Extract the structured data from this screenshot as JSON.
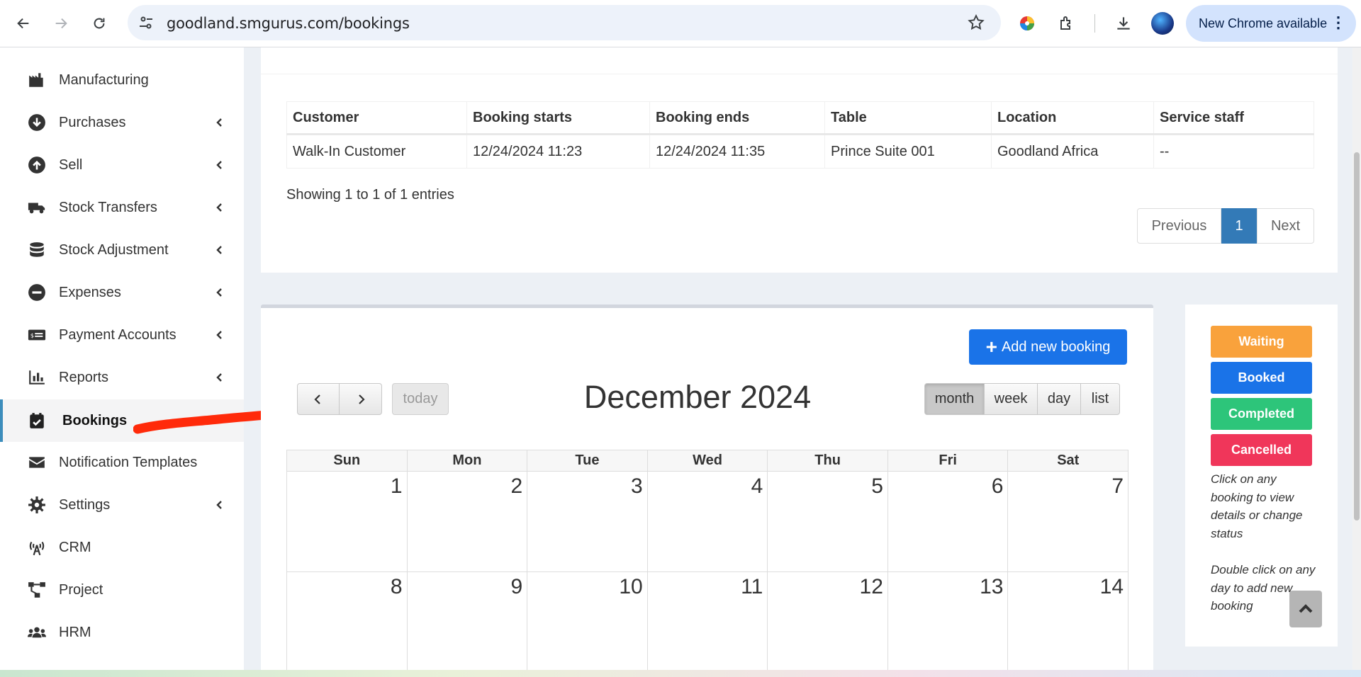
{
  "browser": {
    "url": "goodland.smgurus.com/bookings",
    "update_label": "New Chrome available"
  },
  "sidebar": {
    "items": [
      {
        "label": "Manufacturing",
        "icon": "industry-icon",
        "submenu": false
      },
      {
        "label": "Purchases",
        "icon": "arrow-circle-down-icon",
        "submenu": true
      },
      {
        "label": "Sell",
        "icon": "arrow-circle-up-icon",
        "submenu": true
      },
      {
        "label": "Stock Transfers",
        "icon": "truck-icon",
        "submenu": true
      },
      {
        "label": "Stock Adjustment",
        "icon": "database-icon",
        "submenu": true
      },
      {
        "label": "Expenses",
        "icon": "minus-circle-icon",
        "submenu": true
      },
      {
        "label": "Payment Accounts",
        "icon": "money-check-icon",
        "submenu": true
      },
      {
        "label": "Reports",
        "icon": "chart-bar-icon",
        "submenu": true
      },
      {
        "label": "Bookings",
        "icon": "calendar-check-icon",
        "submenu": false,
        "active": true
      },
      {
        "label": "Notification Templates",
        "icon": "envelope-icon",
        "submenu": false
      },
      {
        "label": "Settings",
        "icon": "cog-icon",
        "submenu": true
      },
      {
        "label": "CRM",
        "icon": "broadcast-tower-icon",
        "submenu": false
      },
      {
        "label": "Project",
        "icon": "project-diagram-icon",
        "submenu": false
      },
      {
        "label": "HRM",
        "icon": "users-icon",
        "submenu": false
      }
    ]
  },
  "bookings_table": {
    "columns": [
      "Customer",
      "Booking starts",
      "Booking ends",
      "Table",
      "Location",
      "Service staff"
    ],
    "rows": [
      [
        "Walk-In Customer",
        "12/24/2024 11:23",
        "12/24/2024 11:35",
        "Prince Suite 001",
        "Goodland Africa",
        "--"
      ]
    ],
    "showing": "Showing 1 to 1 of 1 entries",
    "pagination": {
      "previous": "Previous",
      "current": "1",
      "next": "Next"
    }
  },
  "calendar": {
    "add_button": "Add new booking",
    "today": "today",
    "title": "December 2024",
    "views": [
      "month",
      "week",
      "day",
      "list"
    ],
    "selected_view": "month",
    "weekdays": [
      "Sun",
      "Mon",
      "Tue",
      "Wed",
      "Thu",
      "Fri",
      "Sat"
    ],
    "weeks": [
      [
        "1",
        "2",
        "3",
        "4",
        "5",
        "6",
        "7"
      ],
      [
        "8",
        "9",
        "10",
        "11",
        "12",
        "13",
        "14"
      ]
    ]
  },
  "legend": {
    "statuses": [
      {
        "label": "Waiting",
        "color": "#f9a23c"
      },
      {
        "label": "Booked",
        "color": "#1a73e8"
      },
      {
        "label": "Completed",
        "color": "#2dc57a"
      },
      {
        "label": "Cancelled",
        "color": "#f0365a"
      }
    ],
    "note_1": "Click on any booking to view details or change status",
    "note_2": "Double click on any day to add new booking"
  }
}
